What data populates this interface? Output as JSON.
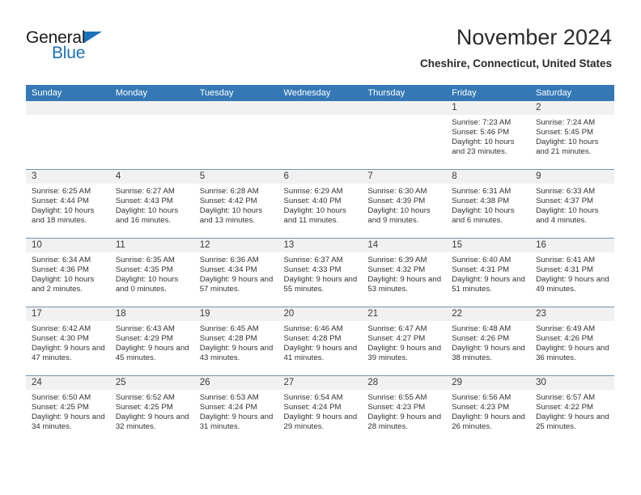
{
  "brand": {
    "name_part1": "General",
    "name_part2": "Blue"
  },
  "header": {
    "title": "November 2024",
    "subtitle": "Cheshire, Connecticut, United States"
  },
  "weekday_headers": [
    "Sunday",
    "Monday",
    "Tuesday",
    "Wednesday",
    "Thursday",
    "Friday",
    "Saturday"
  ],
  "colors": {
    "header_blue": "#3479b5",
    "brand_blue": "#1b72b8",
    "daynum_band": "#f1f1f1",
    "row_divider": "#7b93a8"
  },
  "labels": {
    "sunrise_prefix": "Sunrise:",
    "sunset_prefix": "Sunset:",
    "daylight_prefix": "Daylight:"
  },
  "weeks": [
    [
      {
        "day": "",
        "empty": true
      },
      {
        "day": "",
        "empty": true
      },
      {
        "day": "",
        "empty": true
      },
      {
        "day": "",
        "empty": true
      },
      {
        "day": "",
        "empty": true
      },
      {
        "day": "1",
        "sunrise": "Sunrise: 7:23 AM",
        "sunset": "Sunset: 5:46 PM",
        "daylight": "Daylight: 10 hours and 23 minutes."
      },
      {
        "day": "2",
        "sunrise": "Sunrise: 7:24 AM",
        "sunset": "Sunset: 5:45 PM",
        "daylight": "Daylight: 10 hours and 21 minutes."
      }
    ],
    [
      {
        "day": "3",
        "sunrise": "Sunrise: 6:25 AM",
        "sunset": "Sunset: 4:44 PM",
        "daylight": "Daylight: 10 hours and 18 minutes."
      },
      {
        "day": "4",
        "sunrise": "Sunrise: 6:27 AM",
        "sunset": "Sunset: 4:43 PM",
        "daylight": "Daylight: 10 hours and 16 minutes."
      },
      {
        "day": "5",
        "sunrise": "Sunrise: 6:28 AM",
        "sunset": "Sunset: 4:42 PM",
        "daylight": "Daylight: 10 hours and 13 minutes."
      },
      {
        "day": "6",
        "sunrise": "Sunrise: 6:29 AM",
        "sunset": "Sunset: 4:40 PM",
        "daylight": "Daylight: 10 hours and 11 minutes."
      },
      {
        "day": "7",
        "sunrise": "Sunrise: 6:30 AM",
        "sunset": "Sunset: 4:39 PM",
        "daylight": "Daylight: 10 hours and 9 minutes."
      },
      {
        "day": "8",
        "sunrise": "Sunrise: 6:31 AM",
        "sunset": "Sunset: 4:38 PM",
        "daylight": "Daylight: 10 hours and 6 minutes."
      },
      {
        "day": "9",
        "sunrise": "Sunrise: 6:33 AM",
        "sunset": "Sunset: 4:37 PM",
        "daylight": "Daylight: 10 hours and 4 minutes."
      }
    ],
    [
      {
        "day": "10",
        "sunrise": "Sunrise: 6:34 AM",
        "sunset": "Sunset: 4:36 PM",
        "daylight": "Daylight: 10 hours and 2 minutes."
      },
      {
        "day": "11",
        "sunrise": "Sunrise: 6:35 AM",
        "sunset": "Sunset: 4:35 PM",
        "daylight": "Daylight: 10 hours and 0 minutes."
      },
      {
        "day": "12",
        "sunrise": "Sunrise: 6:36 AM",
        "sunset": "Sunset: 4:34 PM",
        "daylight": "Daylight: 9 hours and 57 minutes."
      },
      {
        "day": "13",
        "sunrise": "Sunrise: 6:37 AM",
        "sunset": "Sunset: 4:33 PM",
        "daylight": "Daylight: 9 hours and 55 minutes."
      },
      {
        "day": "14",
        "sunrise": "Sunrise: 6:39 AM",
        "sunset": "Sunset: 4:32 PM",
        "daylight": "Daylight: 9 hours and 53 minutes."
      },
      {
        "day": "15",
        "sunrise": "Sunrise: 6:40 AM",
        "sunset": "Sunset: 4:31 PM",
        "daylight": "Daylight: 9 hours and 51 minutes."
      },
      {
        "day": "16",
        "sunrise": "Sunrise: 6:41 AM",
        "sunset": "Sunset: 4:31 PM",
        "daylight": "Daylight: 9 hours and 49 minutes."
      }
    ],
    [
      {
        "day": "17",
        "sunrise": "Sunrise: 6:42 AM",
        "sunset": "Sunset: 4:30 PM",
        "daylight": "Daylight: 9 hours and 47 minutes."
      },
      {
        "day": "18",
        "sunrise": "Sunrise: 6:43 AM",
        "sunset": "Sunset: 4:29 PM",
        "daylight": "Daylight: 9 hours and 45 minutes."
      },
      {
        "day": "19",
        "sunrise": "Sunrise: 6:45 AM",
        "sunset": "Sunset: 4:28 PM",
        "daylight": "Daylight: 9 hours and 43 minutes."
      },
      {
        "day": "20",
        "sunrise": "Sunrise: 6:46 AM",
        "sunset": "Sunset: 4:28 PM",
        "daylight": "Daylight: 9 hours and 41 minutes."
      },
      {
        "day": "21",
        "sunrise": "Sunrise: 6:47 AM",
        "sunset": "Sunset: 4:27 PM",
        "daylight": "Daylight: 9 hours and 39 minutes."
      },
      {
        "day": "22",
        "sunrise": "Sunrise: 6:48 AM",
        "sunset": "Sunset: 4:26 PM",
        "daylight": "Daylight: 9 hours and 38 minutes."
      },
      {
        "day": "23",
        "sunrise": "Sunrise: 6:49 AM",
        "sunset": "Sunset: 4:26 PM",
        "daylight": "Daylight: 9 hours and 36 minutes."
      }
    ],
    [
      {
        "day": "24",
        "sunrise": "Sunrise: 6:50 AM",
        "sunset": "Sunset: 4:25 PM",
        "daylight": "Daylight: 9 hours and 34 minutes."
      },
      {
        "day": "25",
        "sunrise": "Sunrise: 6:52 AM",
        "sunset": "Sunset: 4:25 PM",
        "daylight": "Daylight: 9 hours and 32 minutes."
      },
      {
        "day": "26",
        "sunrise": "Sunrise: 6:53 AM",
        "sunset": "Sunset: 4:24 PM",
        "daylight": "Daylight: 9 hours and 31 minutes."
      },
      {
        "day": "27",
        "sunrise": "Sunrise: 6:54 AM",
        "sunset": "Sunset: 4:24 PM",
        "daylight": "Daylight: 9 hours and 29 minutes."
      },
      {
        "day": "28",
        "sunrise": "Sunrise: 6:55 AM",
        "sunset": "Sunset: 4:23 PM",
        "daylight": "Daylight: 9 hours and 28 minutes."
      },
      {
        "day": "29",
        "sunrise": "Sunrise: 6:56 AM",
        "sunset": "Sunset: 4:23 PM",
        "daylight": "Daylight: 9 hours and 26 minutes."
      },
      {
        "day": "30",
        "sunrise": "Sunrise: 6:57 AM",
        "sunset": "Sunset: 4:22 PM",
        "daylight": "Daylight: 9 hours and 25 minutes."
      }
    ]
  ]
}
